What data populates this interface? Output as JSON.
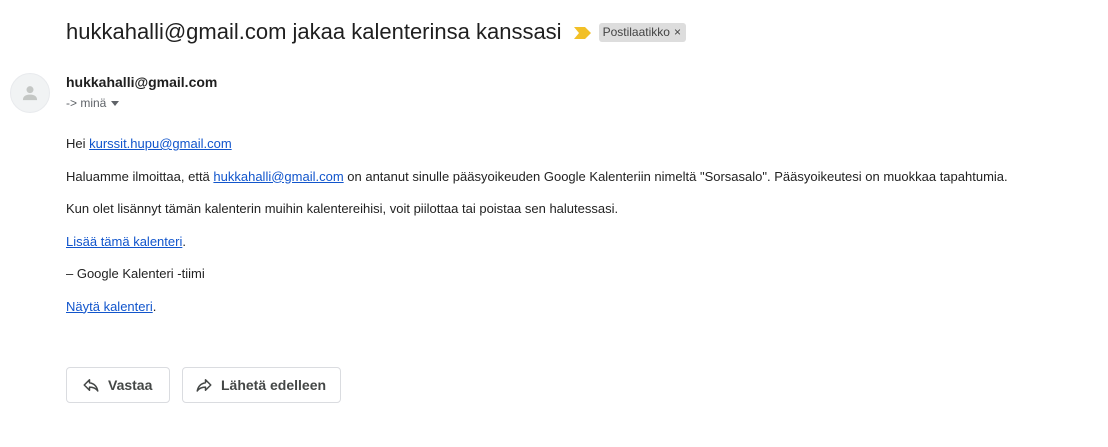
{
  "subject": "hukkahalli@gmail.com jakaa kalenterinsa kanssasi",
  "label_chip": {
    "text": "Postilaatikko",
    "close": "×"
  },
  "sender": {
    "name": "hukkahalli@gmail.com",
    "recipient": "-> minä"
  },
  "body": {
    "greeting_prefix": "Hei ",
    "greeting_email": "kurssit.hupu@gmail.com",
    "line1_prefix": "Haluamme ilmoittaa, että ",
    "line1_email": "hukkahalli@gmail.com",
    "line1_suffix": " on antanut sinulle pääsyoikeuden Google Kalenteriin nimeltä \"Sorsasalo\". Pääsyoikeutesi on muokkaa tapahtumia.",
    "line2": "Kun olet lisännyt tämän kalenterin muihin kalentereihisi, voit piilottaa tai poistaa sen halutessasi.",
    "add_link": "Lisää tämä kalenteri",
    "add_suffix": ".",
    "signature": "– Google Kalenteri -tiimi",
    "view_link": "Näytä kalenteri",
    "view_suffix": "."
  },
  "actions": {
    "reply": "Vastaa",
    "forward": "Lähetä edelleen"
  },
  "icons": {
    "importance": "importance-marker-icon",
    "avatar": "person-icon",
    "reply": "reply-icon",
    "forward": "forward-icon"
  },
  "colors": {
    "link": "#1155cc",
    "importance": "#f2c027",
    "chip_bg": "#dddddd"
  }
}
